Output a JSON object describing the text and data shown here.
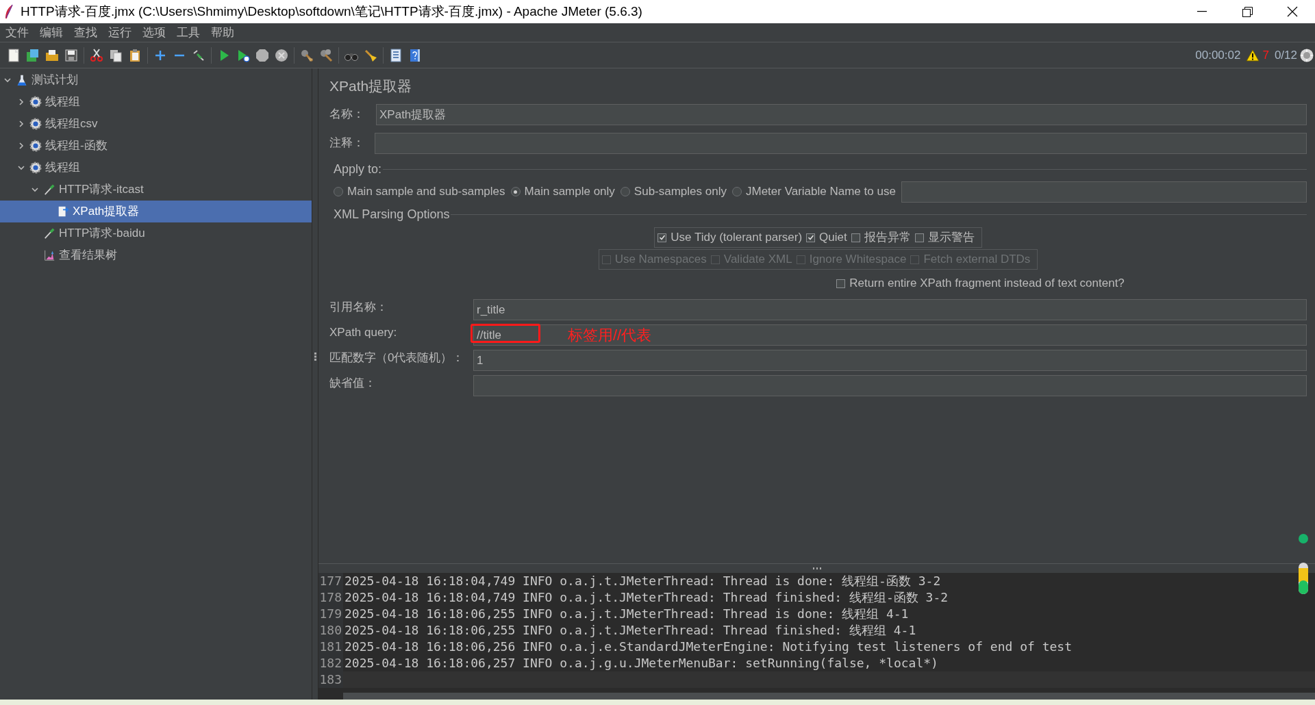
{
  "window": {
    "title": "HTTP请求-百度.jmx (C:\\Users\\Shmimy\\Desktop\\softdown\\笔记\\HTTP请求-百度.jmx) - Apache JMeter (5.6.3)"
  },
  "menu": [
    "文件",
    "编辑",
    "查找",
    "运行",
    "选项",
    "工具",
    "帮助"
  ],
  "status": {
    "elapsed": "00:00:02",
    "warnings": "7",
    "threads": "0/12"
  },
  "tree": [
    {
      "label": "测试计划",
      "kind": "plan",
      "expanded": true,
      "selected": false,
      "children": [
        {
          "label": "线程组",
          "kind": "thread_group",
          "expanded": false,
          "selected": false
        },
        {
          "label": "线程组csv",
          "kind": "thread_group",
          "expanded": false,
          "selected": false
        },
        {
          "label": "线程组-函数",
          "kind": "thread_group",
          "expanded": false,
          "selected": false
        },
        {
          "label": "线程组",
          "kind": "thread_group",
          "expanded": true,
          "selected": false,
          "children": [
            {
              "label": "HTTP请求-itcast",
              "kind": "sampler",
              "expanded": true,
              "selected": false,
              "children": [
                {
                  "label": "XPath提取器",
                  "kind": "extractor",
                  "selected": true
                }
              ]
            },
            {
              "label": "HTTP请求-baidu",
              "kind": "sampler",
              "selected": false
            },
            {
              "label": "查看结果树",
              "kind": "listener",
              "selected": false
            }
          ]
        }
      ]
    }
  ],
  "form": {
    "heading": "XPath提取器",
    "name_label": "名称：",
    "name_value": "XPath提取器",
    "comment_label": "注释：",
    "apply_to": {
      "legend": "Apply to:",
      "options": [
        {
          "label": "Main sample and sub-samples",
          "selected": false
        },
        {
          "label": "Main sample only",
          "selected": true
        },
        {
          "label": "Sub-samples only",
          "selected": false
        },
        {
          "label": "JMeter Variable Name to use",
          "selected": false
        }
      ]
    },
    "xml_options": {
      "legend": "XML Parsing Options",
      "tidy_group": [
        {
          "label": "Use Tidy (tolerant parser)",
          "checked": true,
          "disabled": false
        },
        {
          "label": "Quiet",
          "checked": true,
          "disabled": false
        },
        {
          "label": "报告异常",
          "checked": false,
          "disabled": false
        },
        {
          "label": "显示警告",
          "checked": false,
          "disabled": false
        }
      ],
      "xml_group": [
        {
          "label": "Use Namespaces",
          "checked": false,
          "disabled": true
        },
        {
          "label": "Validate XML",
          "checked": false,
          "disabled": true
        },
        {
          "label": "Ignore Whitespace",
          "checked": false,
          "disabled": true
        },
        {
          "label": "Fetch external DTDs",
          "checked": false,
          "disabled": true
        }
      ]
    },
    "return_fragment": {
      "label": "Return entire XPath fragment instead of text content?",
      "checked": false
    },
    "fields": [
      {
        "label": "引用名称：",
        "value": "r_title",
        "highlighted": false
      },
      {
        "label": "XPath query:",
        "value": "//title",
        "highlighted": true
      },
      {
        "label": "匹配数字（0代表随机）：",
        "value": "1",
        "highlighted": false
      },
      {
        "label": "缺省值：",
        "highlighted": false
      }
    ],
    "annotation": "标签用//代表"
  },
  "log": {
    "lines": [
      {
        "number": "177",
        "text": "2025-04-18 16:18:04,749 INFO o.a.j.t.JMeterThread: Thread is done: 线程组-函数 3-2"
      },
      {
        "number": "178",
        "text": "2025-04-18 16:18:04,749 INFO o.a.j.t.JMeterThread: Thread finished: 线程组-函数 3-2"
      },
      {
        "number": "179",
        "text": "2025-04-18 16:18:06,255 INFO o.a.j.t.JMeterThread: Thread is done: 线程组 4-1"
      },
      {
        "number": "180",
        "text": "2025-04-18 16:18:06,255 INFO o.a.j.t.JMeterThread: Thread finished: 线程组 4-1"
      },
      {
        "number": "181",
        "text": "2025-04-18 16:18:06,256 INFO o.a.j.e.StandardJMeterEngine: Notifying test listeners of end of test"
      },
      {
        "number": "182",
        "text": "2025-04-18 16:18:06,257 INFO o.a.j.g.u.JMeterMenuBar: setRunning(false, *local*)"
      },
      {
        "number": "183"
      }
    ]
  }
}
